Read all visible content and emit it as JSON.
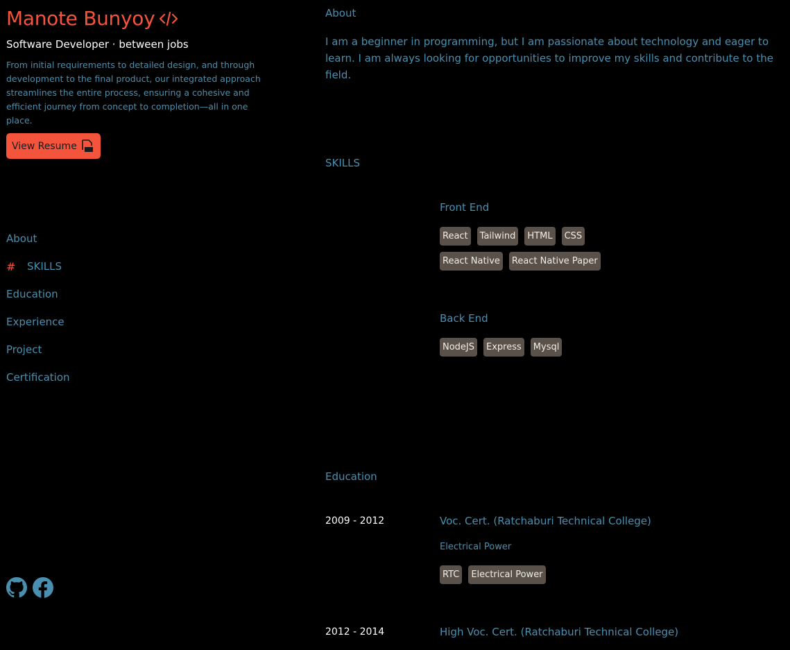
{
  "profile": {
    "name": "Manote Bunyoy",
    "subtitle": "Software Developer · between jobs",
    "intro": "From initial requirements to detailed design, and through development to the final product, our integrated approach streamlines the entire process, ensuring a cohesive and efficient journey from concept to completion—all in one place.",
    "resume_label": "View Resume",
    "accent_color": "#f4533c",
    "text_color": "#4a8fb0"
  },
  "nav": {
    "items": [
      {
        "label": "About"
      },
      {
        "label": "SKILLS",
        "marker": "#"
      },
      {
        "label": "Education"
      },
      {
        "label": "Experience"
      },
      {
        "label": "Project"
      },
      {
        "label": "Certification"
      }
    ],
    "active": "SKILLS"
  },
  "social": {
    "icons": [
      "github-icon",
      "facebook-icon"
    ]
  },
  "about": {
    "title": "About",
    "text": "I am a beginner in programming, but I am passionate about technology and eager to learn. I am always looking for opportunities to improve my skills and contribute to the field."
  },
  "skills": {
    "title": "SKILLS",
    "groups": [
      {
        "title": "Front End",
        "rows": [
          [
            "React",
            "Tailwind",
            "HTML",
            "CSS"
          ],
          [
            "React Native",
            "React Native Paper"
          ]
        ]
      },
      {
        "title": "Back End",
        "rows": [
          [
            "NodeJS",
            "Express",
            "Mysql"
          ]
        ]
      }
    ]
  },
  "education": {
    "title": "Education",
    "entries": [
      {
        "years": "2009 - 2012",
        "title": "Voc. Cert. (Ratchaburi Technical College)",
        "major": "Electrical Power",
        "tags": [
          "RTC",
          "Electrical Power"
        ]
      },
      {
        "years": "2012 - 2014",
        "title": "High Voc. Cert. (Ratchaburi Technical College)"
      }
    ]
  }
}
